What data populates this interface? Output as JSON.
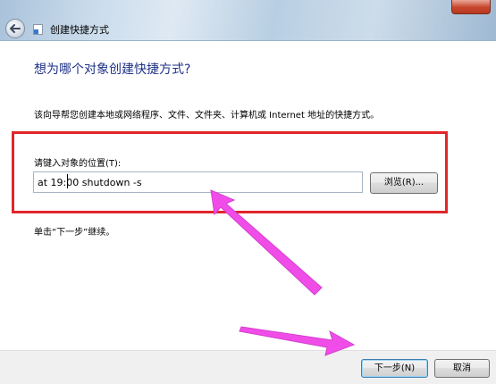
{
  "window": {
    "title": "创建快捷方式"
  },
  "main": {
    "heading": "想为哪个对象创建快捷方式?",
    "description": "该向导帮您创建本地或网络程序、文件、文件夹、计算机或 Internet 地址的快捷方式。",
    "location_label": "请键入对象的位置(T):",
    "location_value": "at 19:00 shutdown -s",
    "browse_label": "浏览(R)...",
    "hint": "单击“下一步”继续。"
  },
  "footer": {
    "next_label": "下一步(N)",
    "cancel_label": "取消"
  },
  "colors": {
    "heading": "#1e3287",
    "highlight": "#e0262a",
    "arrow": "#f04de8"
  }
}
